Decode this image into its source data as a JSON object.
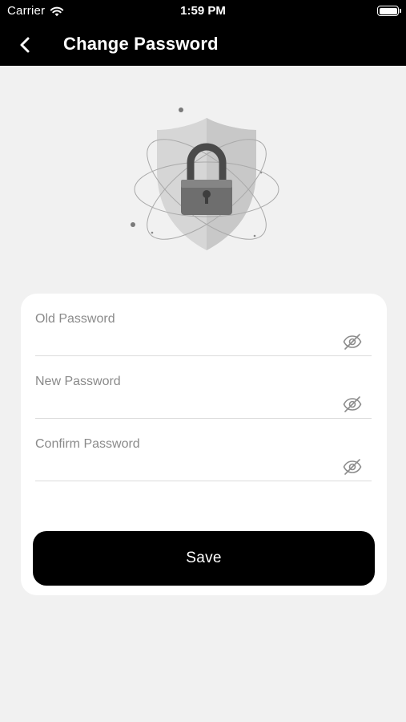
{
  "status_bar": {
    "carrier": "Carrier",
    "time": "1:59 PM",
    "wifi_icon": "wifi-icon",
    "battery_icon": "battery-icon"
  },
  "header": {
    "title": "Change Password",
    "back_icon": "chevron-left-icon"
  },
  "illustration": {
    "icon": "shield-lock-icon"
  },
  "form": {
    "fields": [
      {
        "label": "Old Password",
        "value": "",
        "toggle_icon": "eye-off-icon"
      },
      {
        "label": "New Password",
        "value": "",
        "toggle_icon": "eye-off-icon"
      },
      {
        "label": "Confirm Password",
        "value": "",
        "toggle_icon": "eye-off-icon"
      }
    ],
    "save_label": "Save"
  },
  "colors": {
    "header_background": "#000000",
    "page_background": "#f1f1f1",
    "card_background": "#ffffff",
    "button_background": "#000000"
  }
}
